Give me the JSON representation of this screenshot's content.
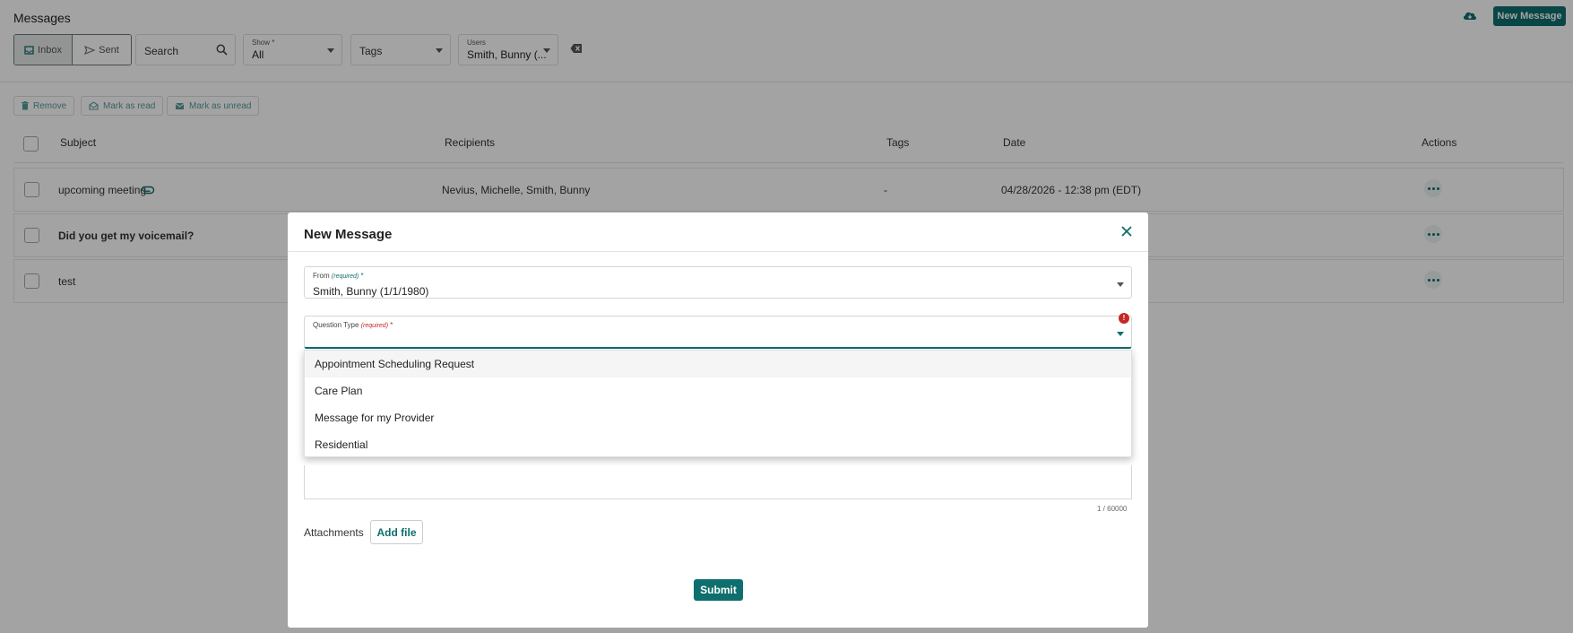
{
  "header": {
    "title": "Messages",
    "new_message_label": "New Message",
    "cloud_icon": "cloud-download-icon"
  },
  "view_toggle": {
    "inbox_label": "Inbox",
    "sent_label": "Sent",
    "active": "Inbox"
  },
  "filters": {
    "search_placeholder": "Search",
    "show": {
      "label": "Show",
      "required_mark": "*",
      "value": "All"
    },
    "tags": {
      "placeholder": "Tags"
    },
    "users": {
      "label": "Users",
      "value": "Smith, Bunny (..."
    }
  },
  "actions": {
    "remove_label": "Remove",
    "mark_read_label": "Mark as read",
    "mark_unread_label": "Mark as unread"
  },
  "table": {
    "columns": [
      "Subject",
      "Recipients",
      "Tags",
      "Date",
      "Actions"
    ],
    "rows": [
      {
        "subject": "upcoming meeting",
        "has_attachment": true,
        "recipients": "Nevius, Michelle, Smith, Bunny",
        "tags": "-",
        "date": "04/28/2026 - 12:38 pm (EDT)"
      },
      {
        "subject": "Did you get my voicemail?",
        "unread": true
      },
      {
        "subject": "test"
      }
    ]
  },
  "modal": {
    "title": "New Message",
    "from": {
      "label": "From",
      "required_note": "(required)",
      "required_mark": "*",
      "value": "Smith, Bunny (1/1/1980)"
    },
    "question_type": {
      "label": "Question Type",
      "required_note": "(required)",
      "required_mark": "*",
      "error_mark": "!"
    },
    "question_type_options": [
      "Appointment Scheduling Request",
      "Care Plan",
      "Message for my Provider",
      "Residential"
    ],
    "char_counter": "1 / 60000",
    "attachments_label": "Attachments",
    "add_file_label": "Add file",
    "submit_label": "Submit"
  },
  "colors": {
    "accent": "#0f6e6e",
    "error": "#c62828",
    "overlay": "rgba(0,0,0,0.36)"
  }
}
